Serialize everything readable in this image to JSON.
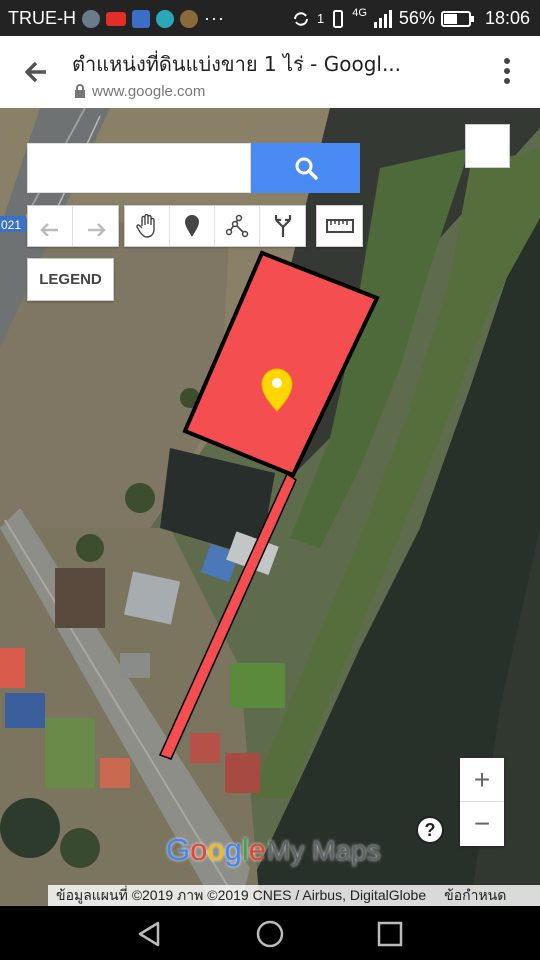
{
  "status_bar": {
    "carrier": "TRUE-H",
    "dots": "···",
    "sim_slot": "1",
    "network": "4G",
    "battery_percent": "56%",
    "battery_level": 0.56,
    "time": "18:06"
  },
  "title_bar": {
    "title": "ตำแหน่งที่ดินแบ่งขาย 1 ไร่ - Googl...",
    "url": "www.google.com",
    "icons": {
      "back": "arrow-left-icon",
      "lock": "lock-icon",
      "menu": "more-vertical-icon"
    }
  },
  "map": {
    "search": {
      "placeholder": "",
      "value": ""
    },
    "search_icon": "search-icon",
    "toolbar_left": [
      "undo-icon",
      "redo-icon"
    ],
    "toolbar_tools": [
      "hand-pan-icon",
      "add-marker-icon",
      "draw-line-icon",
      "directions-icon"
    ],
    "toolbar_measure": [
      "ruler-icon"
    ],
    "legend_label": "LEGEND",
    "road_label": "021",
    "zoom_in": "+",
    "zoom_out": "−",
    "help": "?",
    "logo_google": "Google",
    "logo_mymaps": "My Maps",
    "attribution": "ข้อมูลแผนที่ ©2019 ภาพ ©2019 CNES / Airbus, DigitalGlobe",
    "terms": "ข้อกำหนด",
    "parcel_color": "#f44e50",
    "marker_color": "#ffd600"
  },
  "nav_bar": {
    "icons": [
      "back-triangle-icon",
      "home-circle-icon",
      "recents-square-icon"
    ]
  }
}
